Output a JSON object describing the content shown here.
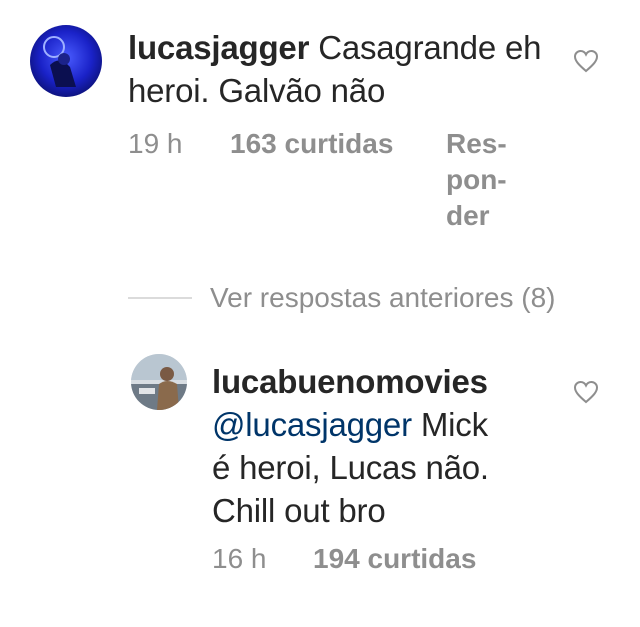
{
  "comments": [
    {
      "username": "lucasjagger",
      "text": "Casagrande eh heroi. Galvão não",
      "time": "19 h",
      "likes": "163 curtidas",
      "reply_lines": [
        "Res-",
        "pon-",
        "der"
      ],
      "avatar_icon": "profile-photo-blue"
    },
    {
      "username": "lucabuenomovies",
      "mention": "@lucasjagger",
      "text_line1": "Mick",
      "text_line2": "é heroi, Lucas não.",
      "text_line3": "Chill out bro",
      "time": "16 h",
      "likes": "194 curtidas",
      "avatar_icon": "profile-photo-person"
    }
  ],
  "view_replies": "Ver respostas anteriores (8)",
  "colors": {
    "text": "#262626",
    "secondary": "#8e8e8e",
    "mention": "#003569",
    "divider": "#dbdbdb"
  }
}
